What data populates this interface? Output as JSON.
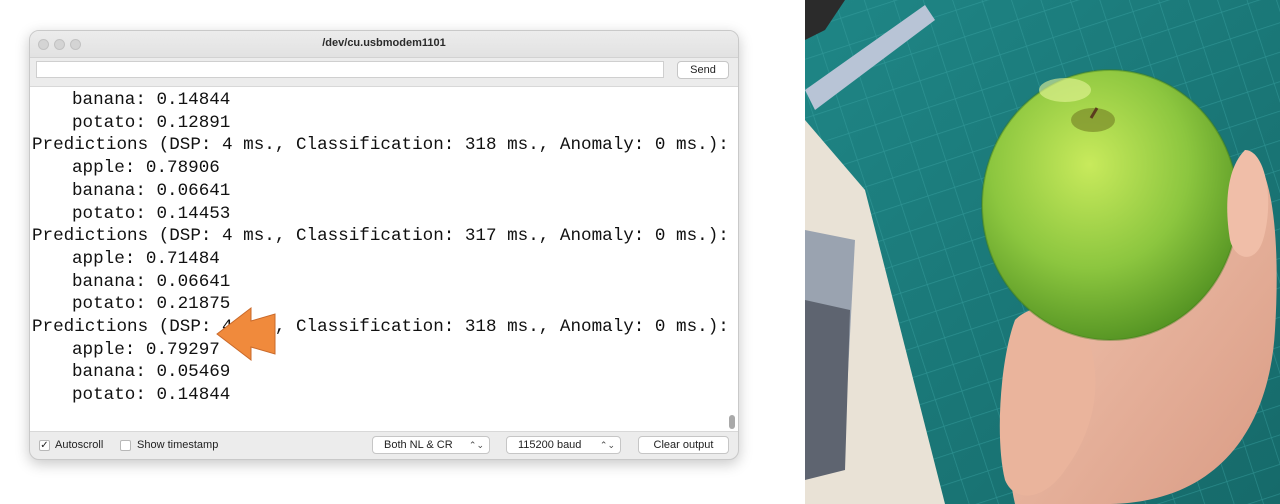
{
  "window": {
    "title": "/dev/cu.usbmodem1101",
    "send_input_value": "",
    "send_label": "Send"
  },
  "output_lines": [
    {
      "text": "banana: 0.14844",
      "indent": true
    },
    {
      "text": "potato: 0.12891",
      "indent": true
    },
    {
      "text": "Predictions (DSP: 4 ms., Classification: 318 ms., Anomaly: 0 ms.):",
      "indent": false
    },
    {
      "text": "apple: 0.78906",
      "indent": true
    },
    {
      "text": "banana: 0.06641",
      "indent": true
    },
    {
      "text": "potato: 0.14453",
      "indent": true
    },
    {
      "text": "Predictions (DSP: 4 ms., Classification: 317 ms., Anomaly: 0 ms.):",
      "indent": false
    },
    {
      "text": "apple: 0.71484",
      "indent": true
    },
    {
      "text": "banana: 0.06641",
      "indent": true
    },
    {
      "text": "potato: 0.21875",
      "indent": true
    },
    {
      "text": "Predictions (DSP: 4 ms., Classification: 318 ms., Anomaly: 0 ms.):",
      "indent": false
    },
    {
      "text": "apple: 0.79297",
      "indent": true
    },
    {
      "text": "banana: 0.05469",
      "indent": true
    },
    {
      "text": "potato: 0.14844",
      "indent": true
    }
  ],
  "bottombar": {
    "autoscroll_label": "Autoscroll",
    "autoscroll_checked": true,
    "timestamp_label": "Show timestamp",
    "timestamp_checked": false,
    "line_ending": "Both NL & CR",
    "baud_rate": "115200 baud",
    "clear_label": "Clear output"
  },
  "colors": {
    "arrow": "#f08a3c",
    "apple": "#8cc63f",
    "mat": "#1c7a7a"
  },
  "icons": [
    "checkmark-icon",
    "select-arrows-icon",
    "pointer-arrow-icon"
  ]
}
